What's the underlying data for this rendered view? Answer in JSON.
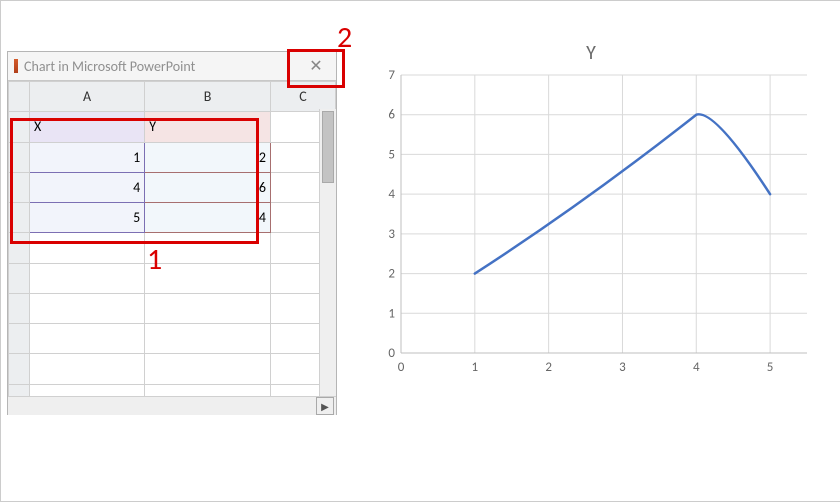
{
  "window": {
    "title": "Chart in Microsoft PowerPoint",
    "close_glyph": "✕"
  },
  "columns": [
    "A",
    "B",
    "C"
  ],
  "rows": [
    {
      "a": "X",
      "b": "Y",
      "c": ""
    },
    {
      "a": "1",
      "b": "2",
      "c": ""
    },
    {
      "a": "4",
      "b": "6",
      "c": ""
    },
    {
      "a": "5",
      "b": "4",
      "c": ""
    }
  ],
  "callouts": {
    "label1": "1",
    "label2": "2"
  },
  "scroll": {
    "right_arrow": "▶"
  },
  "chart_data": {
    "type": "line",
    "title": "Y",
    "xlabel": "",
    "ylabel": "",
    "x_ticks": [
      0,
      1,
      2,
      3,
      4,
      5
    ],
    "y_ticks": [
      0,
      1,
      2,
      3,
      4,
      5,
      6,
      7
    ],
    "xlim": [
      0,
      5.5
    ],
    "ylim": [
      0,
      7
    ],
    "series": [
      {
        "name": "Y",
        "color": "#4472c4",
        "x": [
          1,
          4,
          5
        ],
        "y": [
          2,
          6,
          4
        ]
      }
    ]
  }
}
